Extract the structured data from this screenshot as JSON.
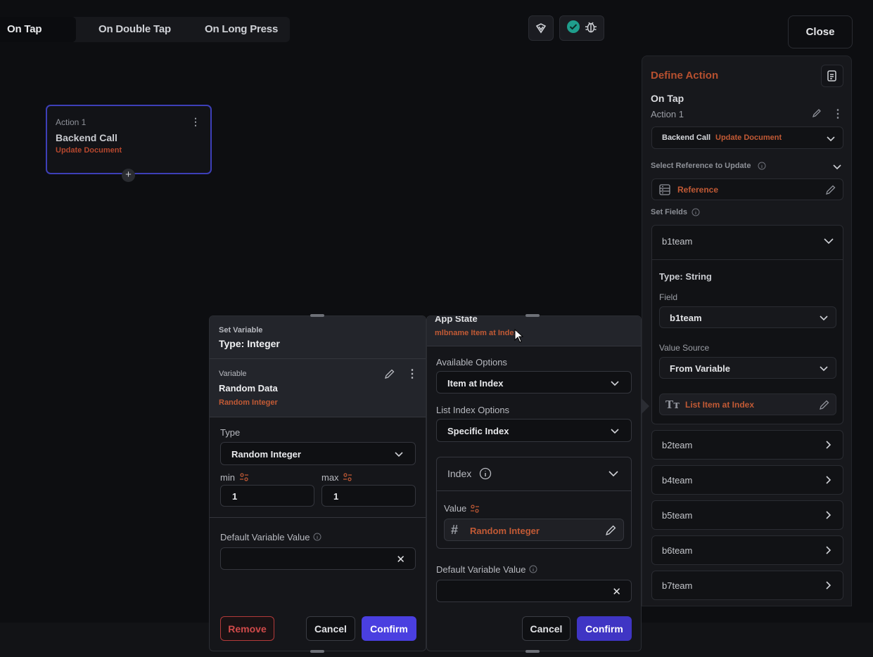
{
  "tabs": [
    "On Tap",
    "On Double Tap",
    "On Long Press"
  ],
  "close_label": "Close",
  "action_card": {
    "label": "Action 1",
    "title": "Backend Call",
    "subtitle": "Update Document"
  },
  "define_action": {
    "title": "Define Action",
    "trigger": "On Tap",
    "action_label": "Action 1",
    "action_type": "Backend Call",
    "action_subtype": "Update Document",
    "select_reference_label": "Select Reference to Update",
    "reference_value": "Reference",
    "set_fields_label": "Set Fields",
    "expanded_field": {
      "name": "b1team",
      "type_label": "Type: String",
      "field_label": "Field",
      "field_value": "b1team",
      "value_source_label": "Value Source",
      "value_source": "From Variable",
      "variable_value": "List Item at Index"
    },
    "fields": [
      "b2team",
      "b4team",
      "b5team",
      "b6team",
      "b7team"
    ]
  },
  "set_variable": {
    "header_small": "Set Variable",
    "header_title": "Type: Integer",
    "variable_label": "Variable",
    "variable_name": "Random Data",
    "variable_sub": "Random Integer",
    "type_label": "Type",
    "type_value": "Random Integer",
    "min_label": "min",
    "min_value": "1",
    "max_label": "max",
    "max_value": "1",
    "default_label": "Default Variable Value",
    "default_value": "",
    "remove": "Remove",
    "cancel": "Cancel",
    "confirm": "Confirm"
  },
  "app_state": {
    "header_title": "App State",
    "header_sub": "mlbname Item at Index",
    "available_options_label": "Available Options",
    "available_options_value": "Item at Index",
    "list_index_label": "List Index Options",
    "list_index_value": "Specific Index",
    "index_label": "Index",
    "value_label": "Value",
    "value_value": "Random Integer",
    "default_label": "Default Variable Value",
    "default_value": "",
    "cancel": "Cancel",
    "confirm": "Confirm"
  },
  "colors": {
    "accent": "#4a3fe0",
    "orange": "#c25a35",
    "danger": "#d04a4a",
    "card_border": "#3d3fb8",
    "success": "#1f9e8c"
  }
}
